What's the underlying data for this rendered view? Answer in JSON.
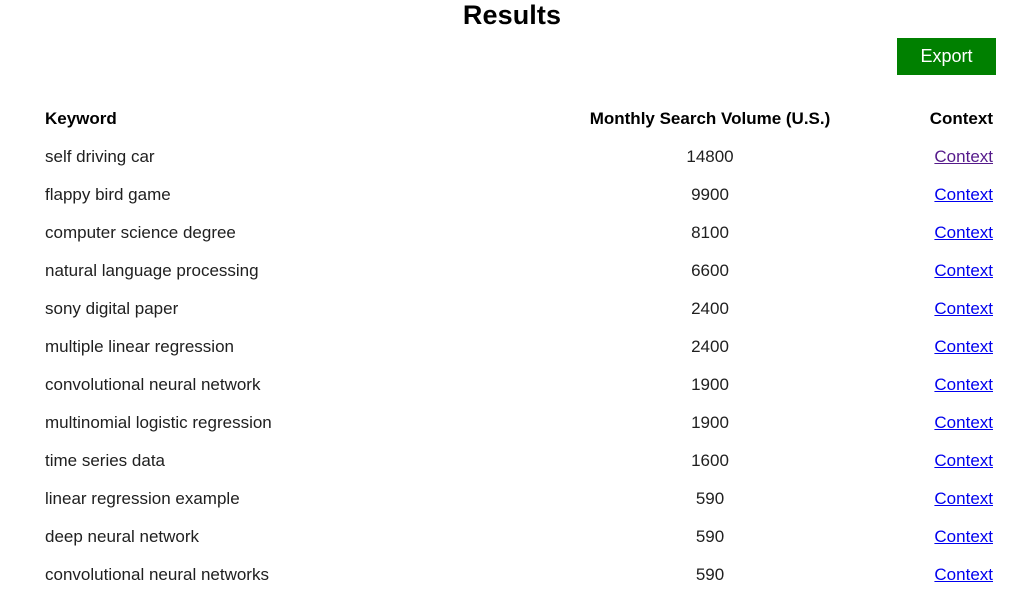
{
  "header": {
    "title": "Results"
  },
  "toolbar": {
    "export_label": "Export",
    "export_bg_color": "#008000",
    "export_text_color": "#FFFFFF"
  },
  "table": {
    "columns": [
      "Keyword",
      "Monthly Search Volume (U.S.)",
      "Context"
    ],
    "link_color": "#0000EE",
    "visited_link_color": "#551A8B",
    "rows": [
      {
        "keyword": "self driving car",
        "volume": "14800",
        "context_label": "Context",
        "visited": true
      },
      {
        "keyword": "flappy bird game",
        "volume": "9900",
        "context_label": "Context",
        "visited": false
      },
      {
        "keyword": "computer science degree",
        "volume": "8100",
        "context_label": "Context",
        "visited": false
      },
      {
        "keyword": "natural language processing",
        "volume": "6600",
        "context_label": "Context",
        "visited": false
      },
      {
        "keyword": "sony digital paper",
        "volume": "2400",
        "context_label": "Context",
        "visited": false
      },
      {
        "keyword": "multiple linear regression",
        "volume": "2400",
        "context_label": "Context",
        "visited": false
      },
      {
        "keyword": "convolutional neural network",
        "volume": "1900",
        "context_label": "Context",
        "visited": false
      },
      {
        "keyword": "multinomial logistic regression",
        "volume": "1900",
        "context_label": "Context",
        "visited": false
      },
      {
        "keyword": "time series data",
        "volume": "1600",
        "context_label": "Context",
        "visited": false
      },
      {
        "keyword": "linear regression example",
        "volume": "590",
        "context_label": "Context",
        "visited": false
      },
      {
        "keyword": "deep neural network",
        "volume": "590",
        "context_label": "Context",
        "visited": false
      },
      {
        "keyword": "convolutional neural networks",
        "volume": "590",
        "context_label": "Context",
        "visited": false
      }
    ]
  }
}
